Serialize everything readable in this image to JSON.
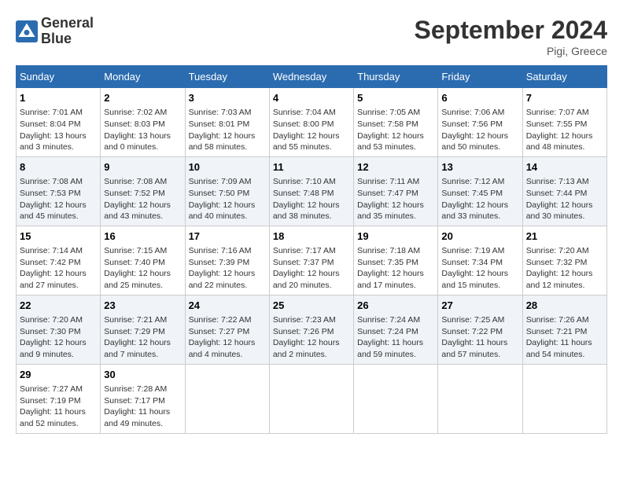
{
  "header": {
    "logo_line1": "General",
    "logo_line2": "Blue",
    "month": "September 2024",
    "location": "Pigi, Greece"
  },
  "days_of_week": [
    "Sunday",
    "Monday",
    "Tuesday",
    "Wednesday",
    "Thursday",
    "Friday",
    "Saturday"
  ],
  "weeks": [
    [
      {
        "day": "1",
        "info": "Sunrise: 7:01 AM\nSunset: 8:04 PM\nDaylight: 13 hours and 3 minutes."
      },
      {
        "day": "2",
        "info": "Sunrise: 7:02 AM\nSunset: 8:03 PM\nDaylight: 13 hours and 0 minutes."
      },
      {
        "day": "3",
        "info": "Sunrise: 7:03 AM\nSunset: 8:01 PM\nDaylight: 12 hours and 58 minutes."
      },
      {
        "day": "4",
        "info": "Sunrise: 7:04 AM\nSunset: 8:00 PM\nDaylight: 12 hours and 55 minutes."
      },
      {
        "day": "5",
        "info": "Sunrise: 7:05 AM\nSunset: 7:58 PM\nDaylight: 12 hours and 53 minutes."
      },
      {
        "day": "6",
        "info": "Sunrise: 7:06 AM\nSunset: 7:56 PM\nDaylight: 12 hours and 50 minutes."
      },
      {
        "day": "7",
        "info": "Sunrise: 7:07 AM\nSunset: 7:55 PM\nDaylight: 12 hours and 48 minutes."
      }
    ],
    [
      {
        "day": "8",
        "info": "Sunrise: 7:08 AM\nSunset: 7:53 PM\nDaylight: 12 hours and 45 minutes."
      },
      {
        "day": "9",
        "info": "Sunrise: 7:08 AM\nSunset: 7:52 PM\nDaylight: 12 hours and 43 minutes."
      },
      {
        "day": "10",
        "info": "Sunrise: 7:09 AM\nSunset: 7:50 PM\nDaylight: 12 hours and 40 minutes."
      },
      {
        "day": "11",
        "info": "Sunrise: 7:10 AM\nSunset: 7:48 PM\nDaylight: 12 hours and 38 minutes."
      },
      {
        "day": "12",
        "info": "Sunrise: 7:11 AM\nSunset: 7:47 PM\nDaylight: 12 hours and 35 minutes."
      },
      {
        "day": "13",
        "info": "Sunrise: 7:12 AM\nSunset: 7:45 PM\nDaylight: 12 hours and 33 minutes."
      },
      {
        "day": "14",
        "info": "Sunrise: 7:13 AM\nSunset: 7:44 PM\nDaylight: 12 hours and 30 minutes."
      }
    ],
    [
      {
        "day": "15",
        "info": "Sunrise: 7:14 AM\nSunset: 7:42 PM\nDaylight: 12 hours and 27 minutes."
      },
      {
        "day": "16",
        "info": "Sunrise: 7:15 AM\nSunset: 7:40 PM\nDaylight: 12 hours and 25 minutes."
      },
      {
        "day": "17",
        "info": "Sunrise: 7:16 AM\nSunset: 7:39 PM\nDaylight: 12 hours and 22 minutes."
      },
      {
        "day": "18",
        "info": "Sunrise: 7:17 AM\nSunset: 7:37 PM\nDaylight: 12 hours and 20 minutes."
      },
      {
        "day": "19",
        "info": "Sunrise: 7:18 AM\nSunset: 7:35 PM\nDaylight: 12 hours and 17 minutes."
      },
      {
        "day": "20",
        "info": "Sunrise: 7:19 AM\nSunset: 7:34 PM\nDaylight: 12 hours and 15 minutes."
      },
      {
        "day": "21",
        "info": "Sunrise: 7:20 AM\nSunset: 7:32 PM\nDaylight: 12 hours and 12 minutes."
      }
    ],
    [
      {
        "day": "22",
        "info": "Sunrise: 7:20 AM\nSunset: 7:30 PM\nDaylight: 12 hours and 9 minutes."
      },
      {
        "day": "23",
        "info": "Sunrise: 7:21 AM\nSunset: 7:29 PM\nDaylight: 12 hours and 7 minutes."
      },
      {
        "day": "24",
        "info": "Sunrise: 7:22 AM\nSunset: 7:27 PM\nDaylight: 12 hours and 4 minutes."
      },
      {
        "day": "25",
        "info": "Sunrise: 7:23 AM\nSunset: 7:26 PM\nDaylight: 12 hours and 2 minutes."
      },
      {
        "day": "26",
        "info": "Sunrise: 7:24 AM\nSunset: 7:24 PM\nDaylight: 11 hours and 59 minutes."
      },
      {
        "day": "27",
        "info": "Sunrise: 7:25 AM\nSunset: 7:22 PM\nDaylight: 11 hours and 57 minutes."
      },
      {
        "day": "28",
        "info": "Sunrise: 7:26 AM\nSunset: 7:21 PM\nDaylight: 11 hours and 54 minutes."
      }
    ],
    [
      {
        "day": "29",
        "info": "Sunrise: 7:27 AM\nSunset: 7:19 PM\nDaylight: 11 hours and 52 minutes."
      },
      {
        "day": "30",
        "info": "Sunrise: 7:28 AM\nSunset: 7:17 PM\nDaylight: 11 hours and 49 minutes."
      },
      {
        "day": "",
        "info": ""
      },
      {
        "day": "",
        "info": ""
      },
      {
        "day": "",
        "info": ""
      },
      {
        "day": "",
        "info": ""
      },
      {
        "day": "",
        "info": ""
      }
    ]
  ]
}
